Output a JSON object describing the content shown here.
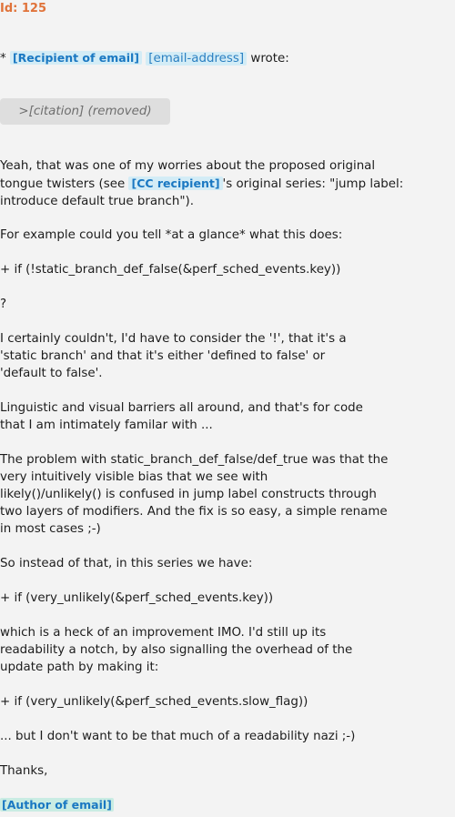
{
  "id_label": "Id: 125",
  "header": {
    "bullet": "*",
    "recipient": "[Recipient of email]",
    "address": "[email-address]",
    "wrote": "wrote:"
  },
  "citation": ">[citation] (removed)",
  "body": {
    "p1_a": "Yeah, that was one of my worries about the proposed original\ntongue twisters (see ",
    "cc": "[CC recipient]",
    "p1_b": "'s original series: \"jump label:\nintroduce default true branch\").",
    "p2": "For example could you tell *at a glance* what this does:",
    "p3": "+ if (!static_branch_def_false(&perf_sched_events.key))",
    "p4": "?",
    "p5": "I certainly couldn't, I'd have to consider the '!', that it's a\n'static branch' and that it's either 'defined to false' or\n'default to false'.",
    "p6": "Linguistic and visual barriers all around, and that's for code\nthat I am intimately familar with ...",
    "p7": "The problem with static_branch_def_false/def_true was that the\nvery intuitively visible bias that we see with\nlikely()/unlikely() is confused in jump label constructs through\ntwo layers of modifiers. And the fix is so easy, a simple rename\nin most cases ;-)",
    "p8": "So instead of that, in this series we have:",
    "p9": "+ if (very_unlikely(&perf_sched_events.key))",
    "p10": "which is a heck of an improvement IMO. I'd still up its\nreadability a notch, by also signalling the overhead of the\nupdate path by making it:",
    "p11": "+ if (very_unlikely(&perf_sched_events.slow_flag))",
    "p12": "... but I don't want to be that much of a readability nazi ;-)",
    "p13": "Thanks,",
    "author": "[Author of email]"
  }
}
